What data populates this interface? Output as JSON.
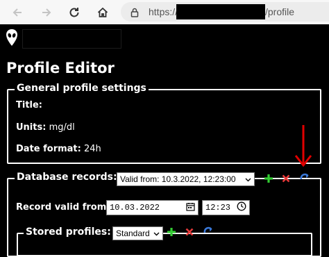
{
  "browser": {
    "url_scheme": "https://",
    "url_path": "/profile",
    "icons": [
      "back-icon",
      "forward-icon",
      "reload-icon",
      "home-icon",
      "lock-icon"
    ]
  },
  "page": {
    "title": "Profile Editor"
  },
  "general": {
    "legend": "General profile settings",
    "title_label": "Title:",
    "title_value": "",
    "units_label": "Units:",
    "units_value": "mg/dl",
    "date_format_label": "Date format:",
    "date_format_value": "24h"
  },
  "database": {
    "legend": "Database records:",
    "selected_record": "Valid from: 10.3.2022, 12:23:00",
    "record_valid_from_label": "Record valid from:",
    "date_value": "10.03.2022",
    "time_value": "12:23",
    "icons": [
      "add-icon",
      "delete-icon",
      "undo-icon"
    ]
  },
  "stored": {
    "legend": "Stored profiles:",
    "selected_profile": "Standard"
  },
  "colors": {
    "add": "#33cc33",
    "delete": "#e83a3a",
    "undo": "#3a78d8",
    "annotation_arrow": "#e00000"
  }
}
